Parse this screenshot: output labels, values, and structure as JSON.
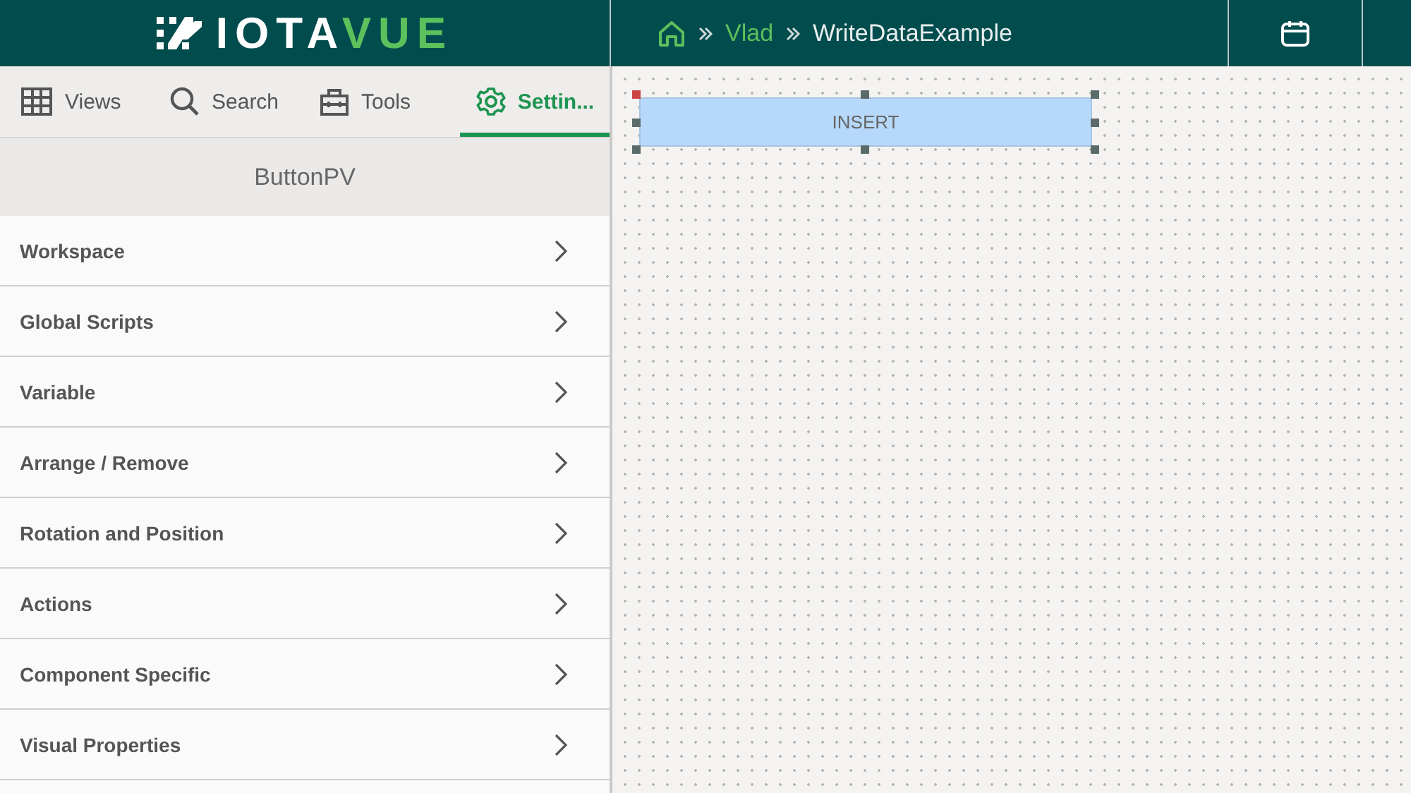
{
  "logo": {
    "primary": "IOTA",
    "accent": "VUE"
  },
  "breadcrumb": [
    {
      "label": "Vlad",
      "kind": "link"
    },
    {
      "label": "WriteDataExample",
      "kind": "current"
    }
  ],
  "tabs": [
    {
      "label": "Views",
      "kind": "grid",
      "selected": false
    },
    {
      "label": "Search",
      "kind": "search",
      "selected": false
    },
    {
      "label": "Tools",
      "kind": "toolbox",
      "selected": false
    },
    {
      "label": "Settin...",
      "kind": "gear",
      "selected": true
    }
  ],
  "panel_title": "ButtonPV",
  "sections": [
    "Workspace",
    "Global Scripts",
    "Variable",
    "Arrange / Remove",
    "Rotation and Position",
    "Actions",
    "Component Specific",
    "Visual Properties"
  ],
  "canvas": {
    "widget": {
      "label": "INSERT",
      "selected": true
    }
  }
}
